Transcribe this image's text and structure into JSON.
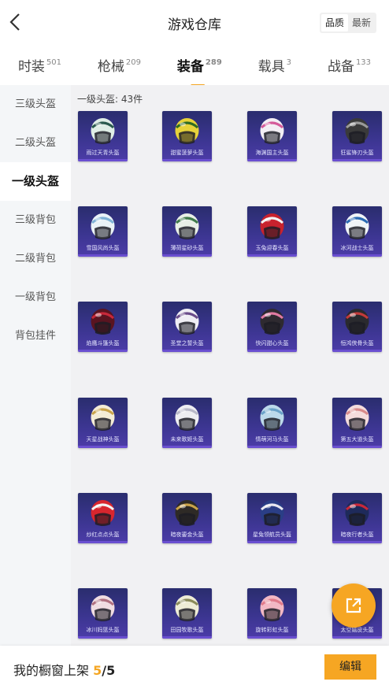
{
  "header": {
    "title": "游戏仓库",
    "sort_options": [
      "品质",
      "最新"
    ]
  },
  "tabs": [
    {
      "label": "时装",
      "count": "501",
      "active": false
    },
    {
      "label": "枪械",
      "count": "209",
      "active": false
    },
    {
      "label": "装备",
      "count": "289",
      "active": true
    },
    {
      "label": "载具",
      "count": "3",
      "active": false
    },
    {
      "label": "战备",
      "count": "133",
      "active": false
    }
  ],
  "sidebar": {
    "items": [
      "三级头盔",
      "二级头盔",
      "一级头盔",
      "三级背包",
      "二级背包",
      "一级背包",
      "背包挂件"
    ],
    "active_index": 2
  },
  "main": {
    "section_label": "一级头盔: 43件",
    "items": [
      {
        "name": "雨过天青头盔",
        "color": "#dfeee6",
        "accent": "#2a5a4e"
      },
      {
        "name": "甜蜜菠萝头盔",
        "color": "#e6d23a",
        "accent": "#2e6b22"
      },
      {
        "name": "海渊国主头盔",
        "color": "#f2eef4",
        "accent": "#d45a9a"
      },
      {
        "name": "狂鲨锋刃头盔",
        "color": "#3a3a3a",
        "accent": "#9a9a9a"
      },
      {
        "name": "雪国风尚头盔",
        "color": "#eaf2f7",
        "accent": "#7fb2d6"
      },
      {
        "name": "薄荷星砂头盔",
        "color": "#e8efe6",
        "accent": "#3f7a4a"
      },
      {
        "name": "玉兔迎春头盔",
        "color": "#c8222e",
        "accent": "#f2f2f2"
      },
      {
        "name": "冰河战士头盔",
        "color": "#f0f4f7",
        "accent": "#2a6ab2"
      },
      {
        "name": "焰鹰斗篷头盔",
        "color": "#5a1420",
        "accent": "#c8283a"
      },
      {
        "name": "圣堂之誓头盔",
        "color": "#efeef4",
        "accent": "#6a4c8a"
      },
      {
        "name": "快闪甜心头盔",
        "color": "#2e2a30",
        "accent": "#e07aa2"
      },
      {
        "name": "恒鸿侠骨头盔",
        "color": "#2a2a2e",
        "accent": "#c23a3a"
      },
      {
        "name": "天星战神头盔",
        "color": "#f4ecd6",
        "accent": "#c9a24a"
      },
      {
        "name": "未来歌姬头盔",
        "color": "#eeeef2",
        "accent": "#b8b8c8"
      },
      {
        "name": "情萌河马头盔",
        "color": "#bcd9ea",
        "accent": "#6aa2c8"
      },
      {
        "name": "第五大道头盔",
        "color": "#f4dcdc",
        "accent": "#d88a8a"
      },
      {
        "name": "炒红点点头盔",
        "color": "#d8262e",
        "accent": "#f2f2f2"
      },
      {
        "name": "暗夜鎏金头盔",
        "color": "#2e2a26",
        "accent": "#c9a24a"
      },
      {
        "name": "星兔领航员头盔",
        "color": "#2a3e86",
        "accent": "#e8e8f0"
      },
      {
        "name": "暗夜行者头盔",
        "color": "#1e2a5a",
        "accent": "#c8283a"
      },
      {
        "name": "冰川妈篮头盔",
        "color": "#f0dde2",
        "accent": "#b07080"
      },
      {
        "name": "田园牧歌头盔",
        "color": "#eeecd6",
        "accent": "#8a8a5a"
      },
      {
        "name": "旋转彩虹头盔",
        "color": "#f2b8c4",
        "accent": "#e07a8a"
      },
      {
        "name": "太空嬉皮头盔",
        "color": "#e0e8f0",
        "accent": "#7a9ab8"
      }
    ]
  },
  "footer": {
    "label": "我的橱窗上架",
    "count": "5",
    "total": "/5",
    "edit_label": "编辑"
  },
  "colors": {
    "accent": "#f6a623",
    "card_bg": "#3b3590"
  },
  "icons": {
    "back": "chevron-left-icon",
    "share": "external-link-icon"
  }
}
